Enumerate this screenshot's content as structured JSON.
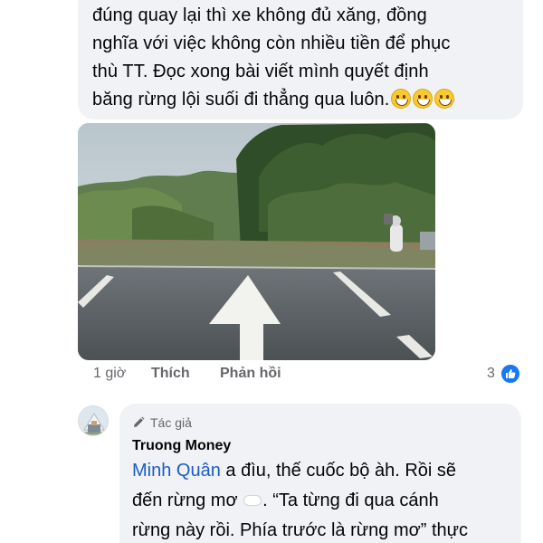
{
  "comment": {
    "line1": "đúng quay lại thì xe không đủ xăng, đồng",
    "line2": "nghĩa với việc không còn nhiều tiền để phục",
    "line3": "thù TT. Đọc xong bài viết mình quyết định",
    "line4": "băng rừng lội suối đi thẳng qua luôn.",
    "emoji": "grinning-face-emoji"
  },
  "actions": {
    "time": "1 giờ",
    "like": "Thích",
    "reply": "Phản hồi",
    "reaction_count": "3"
  },
  "reply": {
    "author_badge": "Tác giả",
    "author_name": "Truong Money",
    "mention": "Minh Quân",
    "text_part1": " a đìu, thế cuốc bộ àh. Rồi sẽ",
    "text_line2a": "đến rừng mơ ",
    "text_line2b": ". “Ta từng đi qua cánh",
    "text_line3": "rừng này rồi. Phía trước là rừng mơ” thực"
  },
  "colors": {
    "bubble": "#f0f2f5",
    "mention": "#1b5ccb",
    "like_blue": "#1877f2",
    "meta": "#65676b"
  }
}
